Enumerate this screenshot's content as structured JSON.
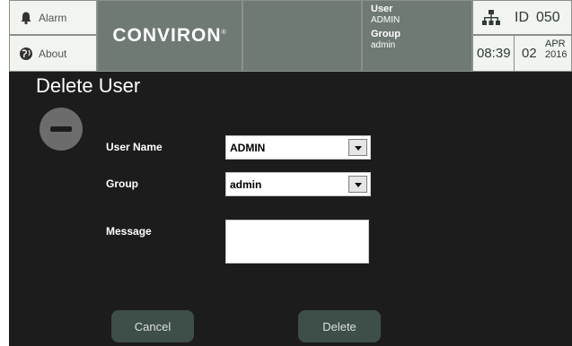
{
  "header": {
    "alarm_label": "Alarm",
    "about_label": "About",
    "logo_text": "CONVIRON",
    "logo_mark": "®",
    "user_key": "User",
    "user_value": "ADMIN",
    "group_key": "Group",
    "group_value": "admin",
    "id_label": "ID",
    "id_value": "050",
    "time": "08:39",
    "day": "02",
    "month": "APR",
    "year": "2016"
  },
  "page": {
    "title": "Delete User"
  },
  "form": {
    "user_name_label": "User Name",
    "user_name_value": "ADMIN",
    "group_label": "Group",
    "group_value": "admin",
    "message_label": "Message",
    "message_value": ""
  },
  "actions": {
    "cancel_label": "Cancel",
    "delete_label": "Delete"
  },
  "colors": {
    "background": "#1c1c1c",
    "header_dark": "#6f7a74",
    "header_light": "#f1f4ef",
    "button": "#3e4e49"
  }
}
